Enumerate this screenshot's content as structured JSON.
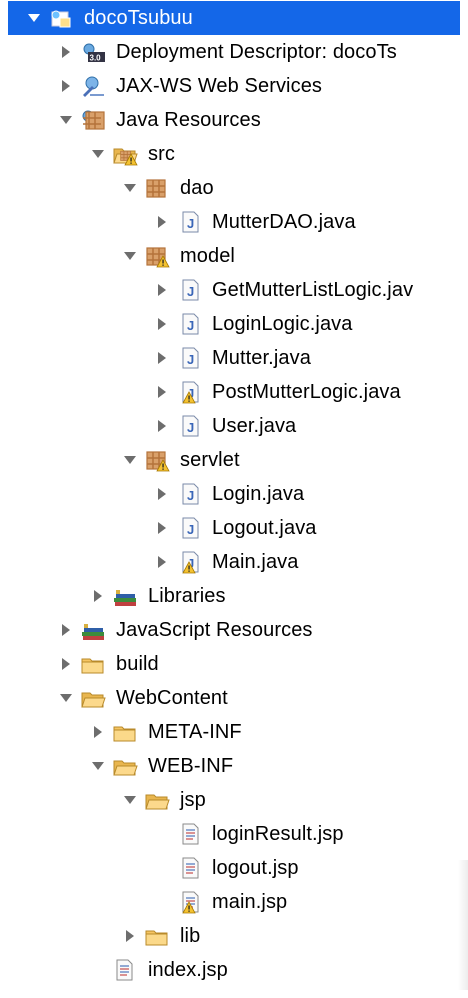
{
  "tree": {
    "items": [
      {
        "label": "docoTsubuu",
        "level": 0,
        "toggle": "expanded",
        "icon": "project-icon",
        "selected": true
      },
      {
        "label": "Deployment Descriptor: docoTs",
        "level": 1,
        "toggle": "collapsed",
        "icon": "deployment-descriptor-icon"
      },
      {
        "label": "JAX-WS Web Services",
        "level": 1,
        "toggle": "collapsed",
        "icon": "web-services-icon"
      },
      {
        "label": "Java Resources",
        "level": 1,
        "toggle": "expanded",
        "icon": "java-resources-icon"
      },
      {
        "label": "src",
        "level": 2,
        "toggle": "expanded",
        "icon": "source-folder-warning-icon"
      },
      {
        "label": "dao",
        "level": 3,
        "toggle": "expanded",
        "icon": "package-icon"
      },
      {
        "label": "MutterDAO.java",
        "level": 4,
        "toggle": "collapsed",
        "icon": "java-file-icon"
      },
      {
        "label": "model",
        "level": 3,
        "toggle": "expanded",
        "icon": "package-warning-icon"
      },
      {
        "label": "GetMutterListLogic.jav",
        "level": 4,
        "toggle": "collapsed",
        "icon": "java-file-icon"
      },
      {
        "label": "LoginLogic.java",
        "level": 4,
        "toggle": "collapsed",
        "icon": "java-file-icon"
      },
      {
        "label": "Mutter.java",
        "level": 4,
        "toggle": "collapsed",
        "icon": "java-file-icon"
      },
      {
        "label": "PostMutterLogic.java",
        "level": 4,
        "toggle": "collapsed",
        "icon": "java-file-warning-icon"
      },
      {
        "label": "User.java",
        "level": 4,
        "toggle": "collapsed",
        "icon": "java-file-icon"
      },
      {
        "label": "servlet",
        "level": 3,
        "toggle": "expanded",
        "icon": "package-warning-icon"
      },
      {
        "label": "Login.java",
        "level": 4,
        "toggle": "collapsed",
        "icon": "java-file-icon"
      },
      {
        "label": "Logout.java",
        "level": 4,
        "toggle": "collapsed",
        "icon": "java-file-icon"
      },
      {
        "label": "Main.java",
        "level": 4,
        "toggle": "collapsed",
        "icon": "java-file-warning-icon"
      },
      {
        "label": "Libraries",
        "level": 2,
        "toggle": "collapsed",
        "icon": "libraries-icon"
      },
      {
        "label": "JavaScript Resources",
        "level": 1,
        "toggle": "collapsed",
        "icon": "javascript-resources-icon"
      },
      {
        "label": "build",
        "level": 1,
        "toggle": "collapsed",
        "icon": "folder-icon"
      },
      {
        "label": "WebContent",
        "level": 1,
        "toggle": "expanded",
        "icon": "folder-open-icon"
      },
      {
        "label": "META-INF",
        "level": 2,
        "toggle": "collapsed",
        "icon": "folder-icon"
      },
      {
        "label": "WEB-INF",
        "level": 2,
        "toggle": "expanded",
        "icon": "folder-open-icon"
      },
      {
        "label": "jsp",
        "level": 3,
        "toggle": "expanded",
        "icon": "folder-open-icon"
      },
      {
        "label": "loginResult.jsp",
        "level": 4,
        "toggle": "none",
        "icon": "jsp-file-icon"
      },
      {
        "label": "logout.jsp",
        "level": 4,
        "toggle": "none",
        "icon": "jsp-file-icon"
      },
      {
        "label": "main.jsp",
        "level": 4,
        "toggle": "none",
        "icon": "jsp-file-warning-icon"
      },
      {
        "label": "lib",
        "level": 3,
        "toggle": "collapsed",
        "icon": "folder-icon"
      },
      {
        "label": "index.jsp",
        "level": 2,
        "toggle": "none",
        "icon": "jsp-file-icon"
      }
    ]
  },
  "colors": {
    "selection": "#1467e8",
    "folder": "#f6c563",
    "package": "#b4733b",
    "warning": "#f4c230",
    "java_file_letter": "#3a66b8"
  }
}
